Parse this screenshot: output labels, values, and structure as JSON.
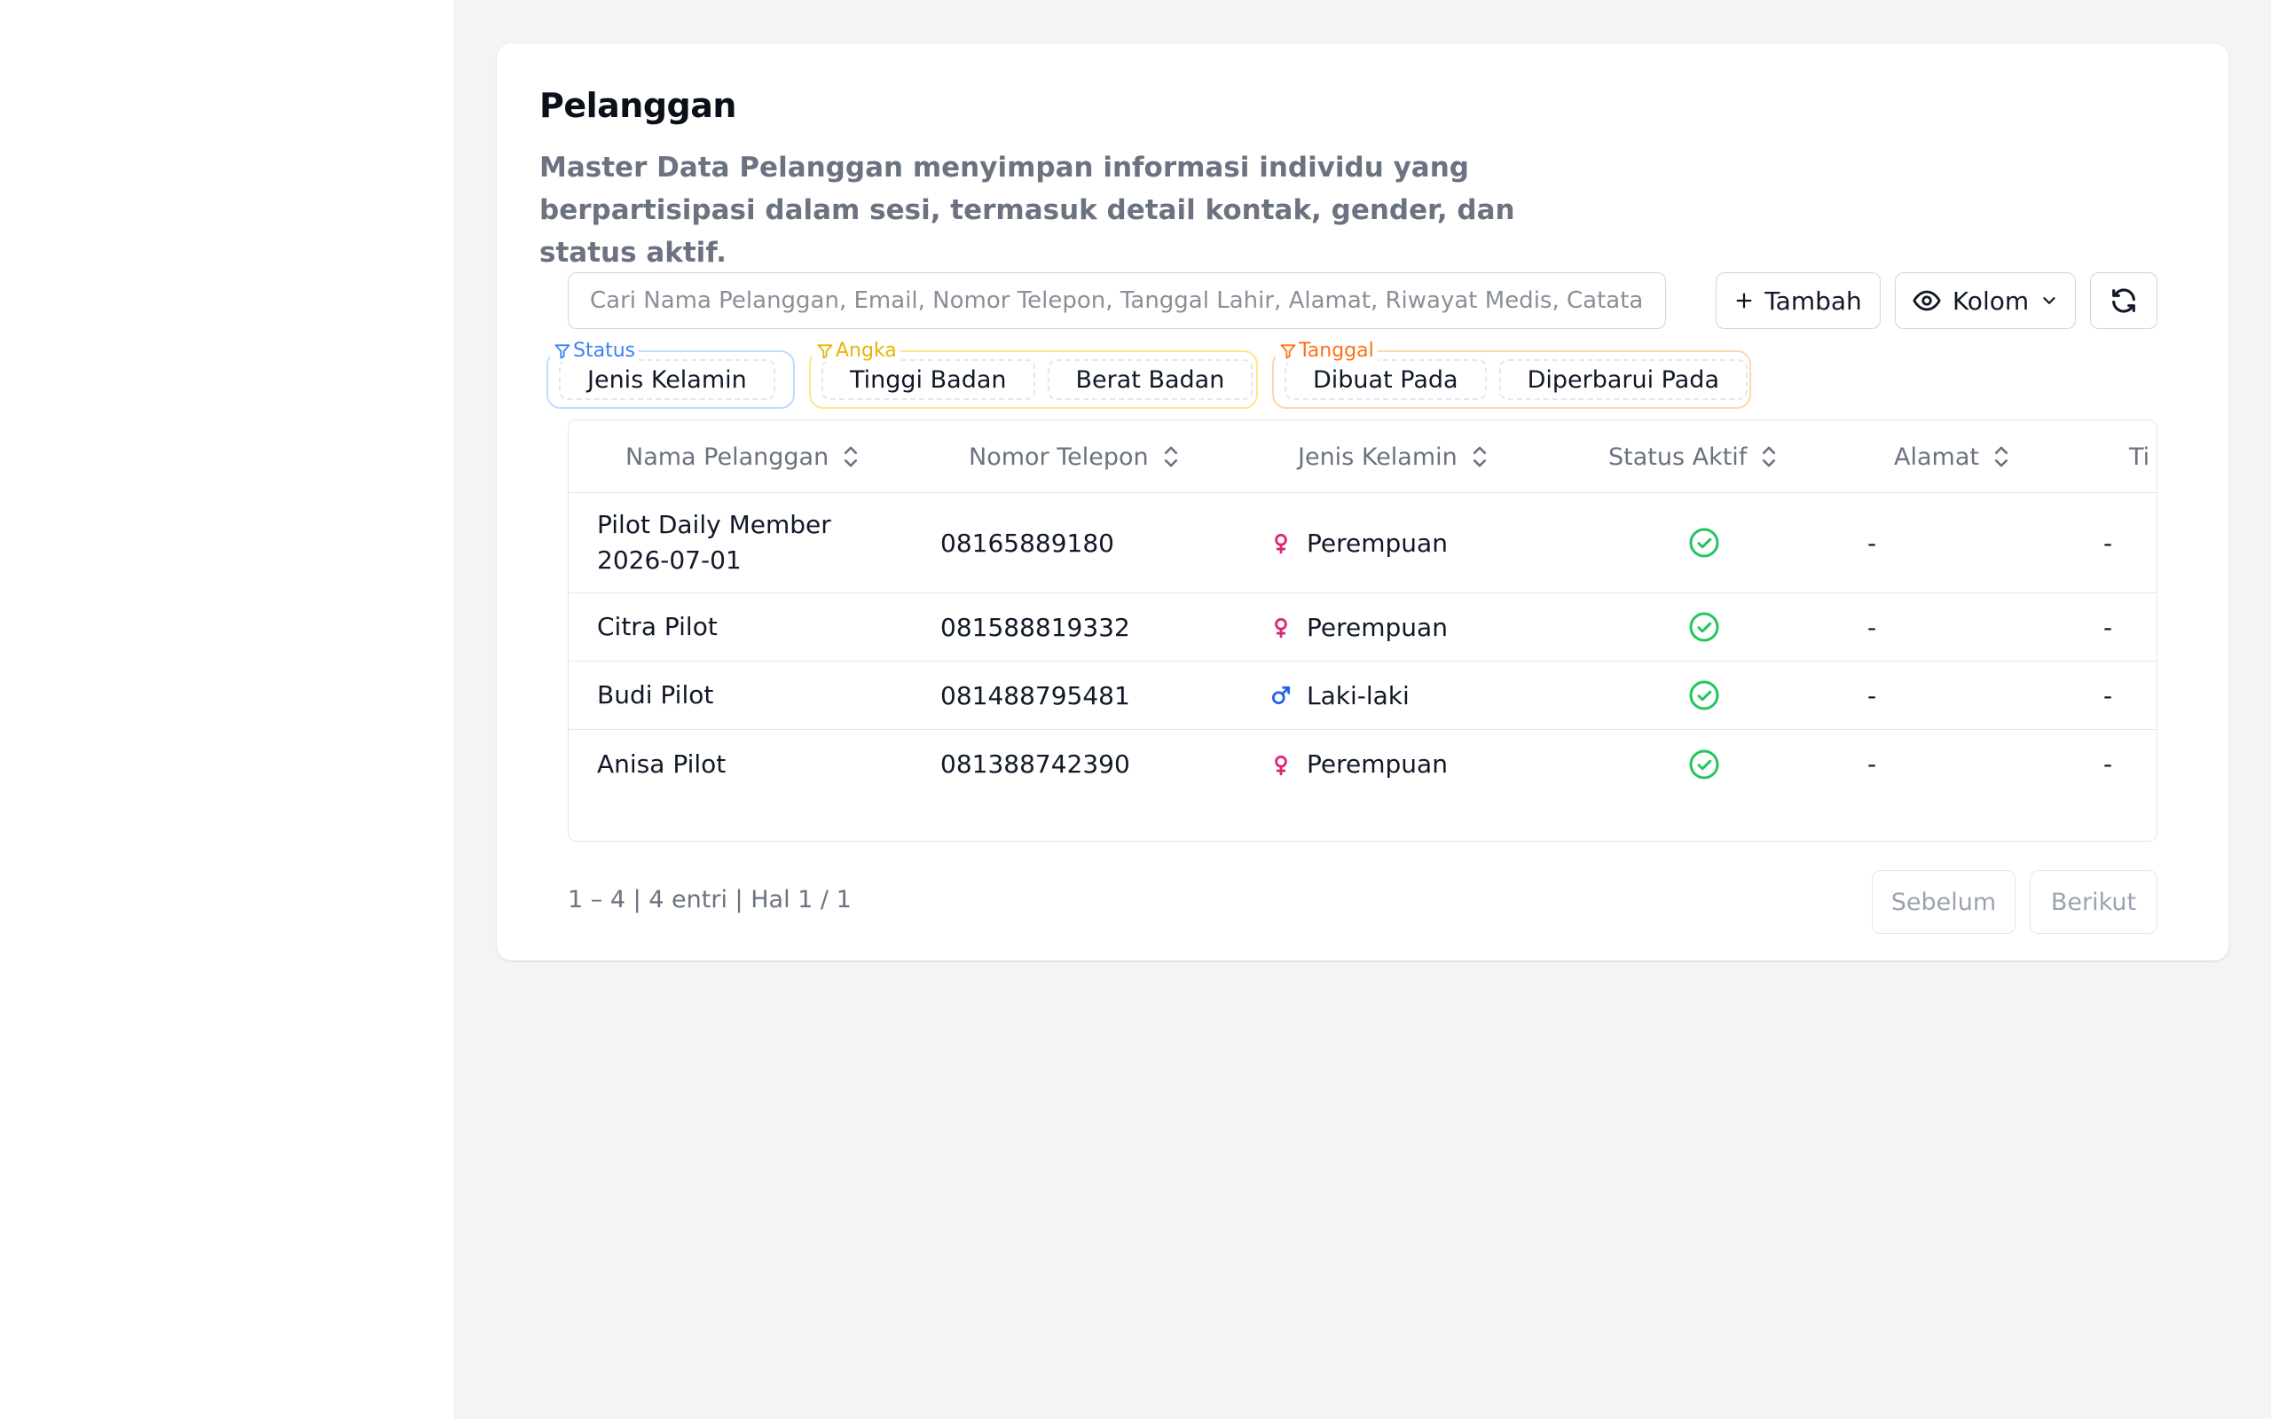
{
  "page": {
    "title": "Pelanggan",
    "description": "Master Data Pelanggan menyimpan informasi individu yang berpartisipasi dalam sesi, termasuk detail kontak, gender, dan status aktif."
  },
  "toolbar": {
    "search_placeholder": "Cari Nama Pelanggan, Email, Nomor Telepon, Tanggal Lahir, Alamat, Riwayat Medis, Catatan, Di",
    "add_label": "Tambah",
    "columns_label": "Kolom"
  },
  "filters": {
    "status": {
      "label": "Status",
      "chips": [
        "Jenis Kelamin"
      ]
    },
    "angka": {
      "label": "Angka",
      "chips": [
        "Tinggi Badan",
        "Berat Badan"
      ]
    },
    "tanggal": {
      "label": "Tanggal",
      "chips": [
        "Dibuat Pada",
        "Diperbarui Pada"
      ]
    }
  },
  "table": {
    "headers": [
      "Nama Pelanggan",
      "Nomor Telepon",
      "Jenis Kelamin",
      "Status Aktif",
      "Alamat",
      "Ti"
    ],
    "rows": [
      {
        "name": "Pilot Daily Member 2026-07-01",
        "phone": "08165889180",
        "gender": "Perempuan",
        "gender_icon": "female-icon",
        "active": true,
        "address": "-",
        "extra": "-"
      },
      {
        "name": "Citra Pilot",
        "phone": "081588819332",
        "gender": "Perempuan",
        "gender_icon": "female-icon",
        "active": true,
        "address": "-",
        "extra": "-"
      },
      {
        "name": "Budi Pilot",
        "phone": "081488795481",
        "gender": "Laki-laki",
        "gender_icon": "male-icon",
        "active": true,
        "address": "-",
        "extra": "-"
      },
      {
        "name": "Anisa Pilot",
        "phone": "081388742390",
        "gender": "Perempuan",
        "gender_icon": "female-icon",
        "active": true,
        "address": "-",
        "extra": "-"
      }
    ]
  },
  "pagination": {
    "info": "1 – 4 | 4 entri | Hal 1 / 1",
    "prev_label": "Sebelum",
    "next_label": "Berikut"
  },
  "colors": {
    "female": "#db2777",
    "male": "#2563eb",
    "active": "#22c55e",
    "status_filter": "#3b82f6",
    "angka_filter": "#eab308",
    "tanggal_filter": "#f97316"
  }
}
